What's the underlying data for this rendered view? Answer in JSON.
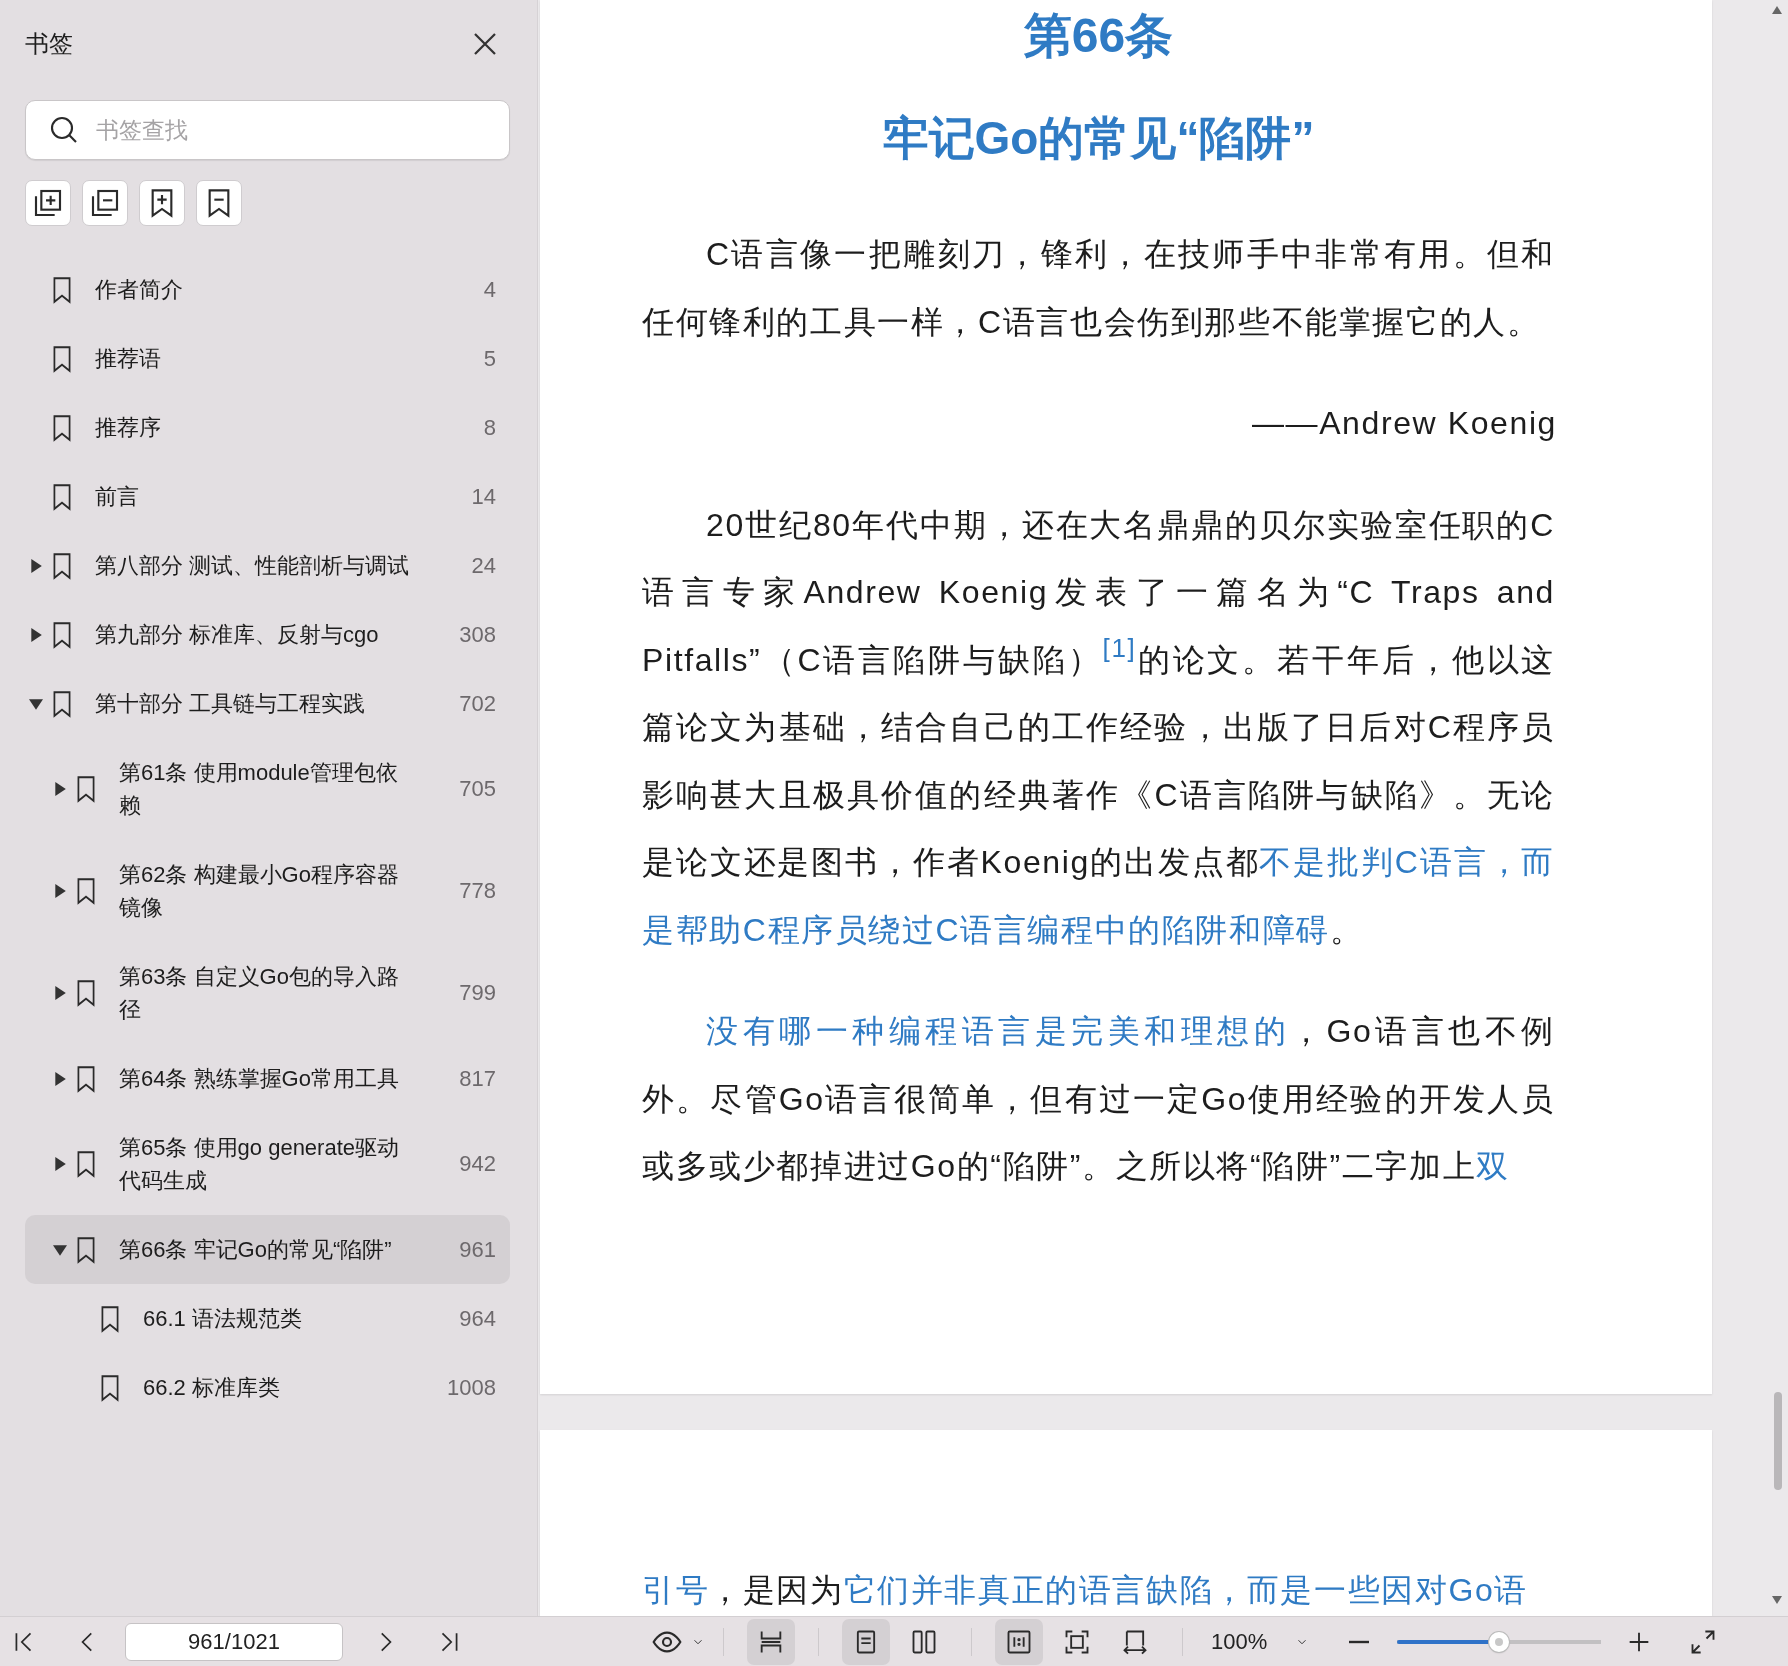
{
  "sidebar": {
    "title": "书签",
    "search": {
      "placeholder": "书签查找"
    },
    "items": [
      {
        "label": "作者简介",
        "page": "4",
        "expandable": false,
        "expanded": false,
        "selected": false
      },
      {
        "label": "推荐语",
        "page": "5",
        "expandable": false,
        "expanded": false,
        "selected": false
      },
      {
        "label": "推荐序",
        "page": "8",
        "expandable": false,
        "expanded": false,
        "selected": false
      },
      {
        "label": "前言",
        "page": "14",
        "expandable": false,
        "expanded": false,
        "selected": false
      },
      {
        "label": "第八部分 测试、性能剖析与调试",
        "page": "24",
        "expandable": true,
        "expanded": false,
        "selected": false
      },
      {
        "label": "第九部分 标准库、反射与cgo",
        "page": "308",
        "expandable": true,
        "expanded": false,
        "selected": false
      },
      {
        "label": "第十部分 工具链与工程实践",
        "page": "702",
        "expandable": true,
        "expanded": true,
        "selected": false,
        "children": [
          {
            "label": "第61条 使用module管理包依赖",
            "page": "705",
            "expandable": true,
            "expanded": false,
            "selected": false
          },
          {
            "label": "第62条 构建最小Go程序容器镜像",
            "page": "778",
            "expandable": true,
            "expanded": false,
            "selected": false
          },
          {
            "label": "第63条 自定义Go包的导入路径",
            "page": "799",
            "expandable": true,
            "expanded": false,
            "selected": false
          },
          {
            "label": "第64条 熟练掌握Go常用工具",
            "page": "817",
            "expandable": true,
            "expanded": false,
            "selected": false
          },
          {
            "label": "第65条 使用go generate驱动代码生成",
            "page": "942",
            "expandable": true,
            "expanded": false,
            "selected": false
          },
          {
            "label": "第66条 牢记Go的常见“陷阱”",
            "page": "961",
            "expandable": true,
            "expanded": true,
            "selected": true,
            "children": [
              {
                "label": "66.1 语法规范类",
                "page": "964",
                "expandable": false,
                "expanded": false,
                "selected": false
              },
              {
                "label": "66.2 标准库类",
                "page": "1008",
                "expandable": false,
                "expanded": false,
                "selected": false
              }
            ]
          }
        ]
      }
    ]
  },
  "document": {
    "chapter_number": "第66条",
    "chapter_title": "牢记Go的常见“陷阱”",
    "paragraphs": [
      {
        "kind": "body",
        "runs": [
          {
            "kind": "plain",
            "text": "C语言像一把雕刻刀，锋利，在技师手中非常有用。但和任何锋利的工具一样，C语言也会伤到那些不能掌握它的人。"
          }
        ]
      },
      {
        "kind": "attribution",
        "runs": [
          {
            "kind": "plain",
            "text": "——Andrew Koenig"
          }
        ]
      },
      {
        "kind": "body",
        "runs": [
          {
            "kind": "plain",
            "text": "20世纪80年代中期，还在大名鼎鼎的贝尔实验室任职的C语言专家Andrew Koenig发表了一篇名为“C Traps and Pitfalls”（C语言陷阱与缺陷）"
          },
          {
            "kind": "ref",
            "text": "[1]"
          },
          {
            "kind": "plain",
            "text": "的论文。若干年后，他以这篇论文为基础，结合自己的工作经验，出版了日后对C程序员影响甚大且极具价值的经典著作《C语言陷阱与缺陷》。无论是论文还是图书，作者Koenig的出发点都"
          },
          {
            "kind": "emphasis",
            "text": "不是批判C语言，而是帮助C程序员绕过C语言编程中的陷阱和障碍"
          },
          {
            "kind": "plain",
            "text": "。"
          }
        ]
      },
      {
        "kind": "body",
        "runs": [
          {
            "kind": "emphasis",
            "text": "没有哪一种编程语言是完美和理想的"
          },
          {
            "kind": "plain",
            "text": "，Go语言也不例外。尽管Go语言很简单，但有过一定Go使用经验的开发人员或多或少都掉进过Go的“陷阱”。之所以将“陷阱”二字加上"
          },
          {
            "kind": "emphasis",
            "text": "双"
          }
        ]
      }
    ],
    "next_page_runs": [
      {
        "kind": "emphasis",
        "text": "引号"
      },
      {
        "kind": "plain",
        "text": "，是因为"
      },
      {
        "kind": "emphasis",
        "text": "它们并非真正的语言缺陷，而是一些因对Go语"
      }
    ]
  },
  "toolbar": {
    "page_field": {
      "value": "961/1021"
    },
    "view_modes": [
      {
        "kind": "continuous",
        "selected": true
      },
      {
        "kind": "single",
        "selected": true
      },
      {
        "kind": "double",
        "selected": false
      }
    ],
    "fit_modes": [
      {
        "kind": "actual",
        "selected": true
      },
      {
        "kind": "page",
        "selected": false
      },
      {
        "kind": "width",
        "selected": false
      }
    ],
    "zoom": {
      "value": "100%"
    },
    "zoom_slider": {
      "level": 0.5
    }
  }
}
